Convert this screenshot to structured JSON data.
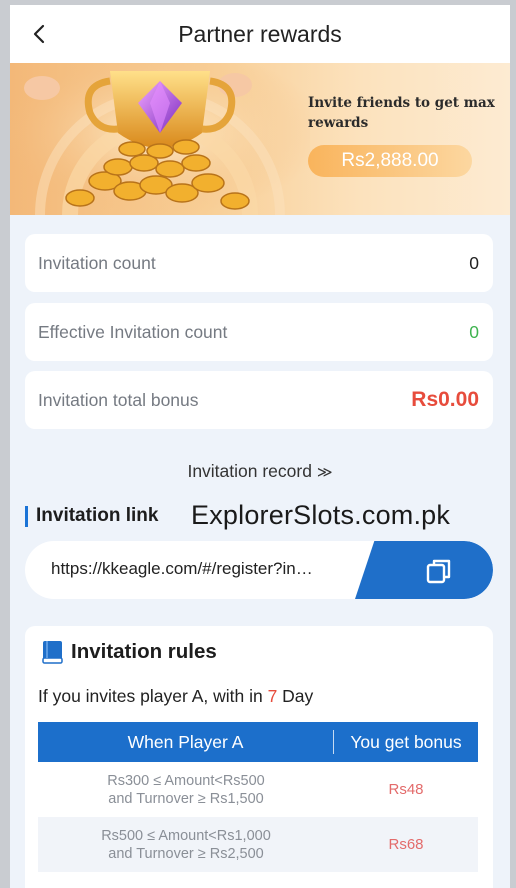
{
  "header": {
    "title": "Partner rewards",
    "back_icon": "chevron-left-icon"
  },
  "banner": {
    "text": "Invite friends to get max rewards",
    "amount": "Rs2,888.00",
    "art_icon": "trophy-coins-icon"
  },
  "stats": [
    {
      "label": "Invitation count",
      "value": "0"
    },
    {
      "label": "Effective Invitation count",
      "value": "0"
    },
    {
      "label": "Invitation total bonus",
      "value": "Rs0.00"
    }
  ],
  "record_link": {
    "label": "Invitation record",
    "chevron": "≫"
  },
  "invitation_link": {
    "title": "Invitation link",
    "url": "https://kkeagle.com/#/register?in…",
    "copy_icon": "copy-icon"
  },
  "watermark": "ExplorerSlots.com.pk",
  "rules": {
    "title": "Invitation rules",
    "desc_prefix": "If you invites player A, with in ",
    "days": "7",
    "desc_suffix": " Day",
    "table": {
      "headers": [
        "When Player A",
        "You get bonus"
      ],
      "rows": [
        {
          "condition_line1": "Rs300 ≤ Amount<Rs500",
          "condition_line2": "and Turnover ≥ Rs1,500",
          "bonus": "Rs48"
        },
        {
          "condition_line1": "Rs500 ≤ Amount<Rs1,000",
          "condition_line2": "and Turnover ≥ Rs2,500",
          "bonus": "Rs68"
        }
      ]
    }
  },
  "colors": {
    "primary": "#1f6fc9",
    "accent_red": "#e74c3c",
    "accent_green": "#3fb34f",
    "banner_gold": "#f3b878"
  }
}
